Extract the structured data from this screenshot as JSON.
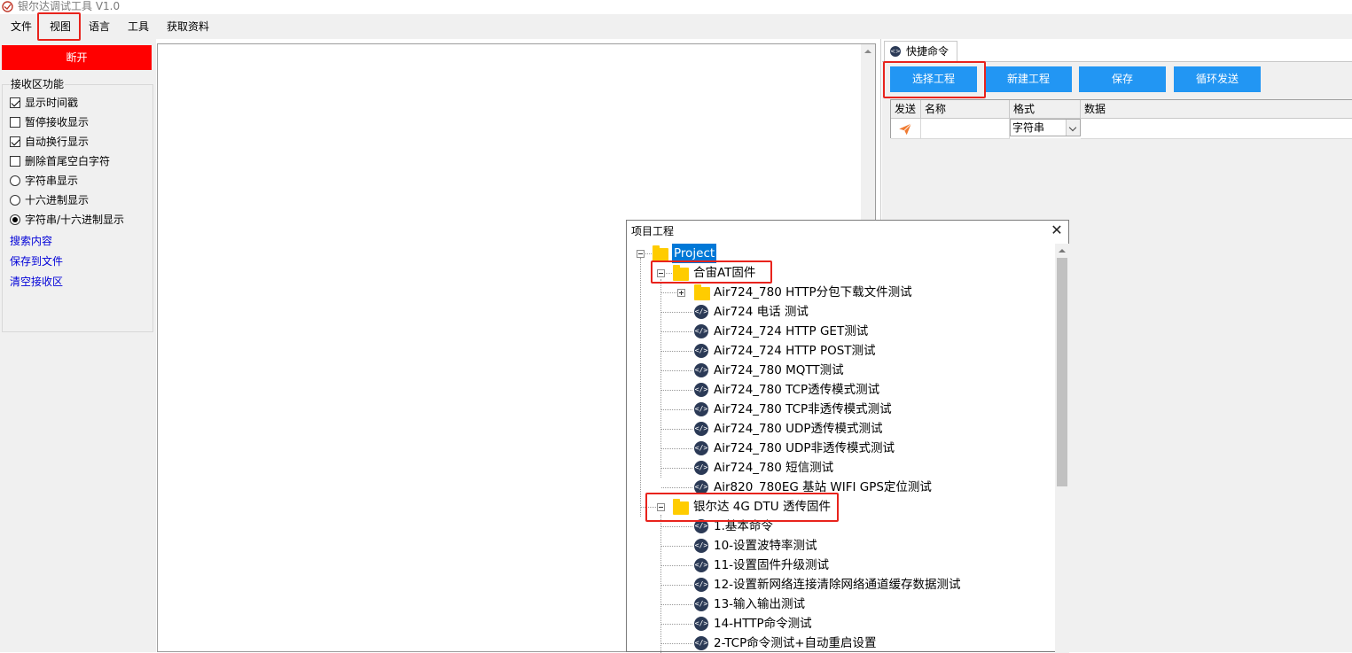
{
  "window": {
    "title": "银尔达调试工具 V1.0"
  },
  "menu": [
    "文件",
    "视图",
    "语言",
    "工具",
    "获取资料"
  ],
  "left_panel": {
    "disconnect_label": "断开",
    "group_title": "接收区功能",
    "options": [
      {
        "label": "显示时间戳",
        "type": "checkbox",
        "checked": true
      },
      {
        "label": "暂停接收显示",
        "type": "checkbox",
        "checked": false
      },
      {
        "label": "自动换行显示",
        "type": "checkbox",
        "checked": true
      },
      {
        "label": "删除首尾空白字符",
        "type": "checkbox",
        "checked": false
      },
      {
        "label": "字符串显示",
        "type": "radio",
        "checked": false
      },
      {
        "label": "十六进制显示",
        "type": "radio",
        "checked": false
      },
      {
        "label": "字符串/十六进制显示",
        "type": "radio",
        "checked": true
      }
    ],
    "links": [
      "搜索内容",
      "保存到文件",
      "清空接收区"
    ]
  },
  "quick_commands": {
    "tab_label": "快捷命令",
    "buttons": [
      "选择工程",
      "新建工程",
      "保存",
      "循环发送"
    ],
    "columns": [
      "发送",
      "名称",
      "格式",
      "数据"
    ],
    "row": {
      "format": "字符串"
    }
  },
  "project_dialog": {
    "title": "项目工程",
    "close_glyph": "✕",
    "root": "Project",
    "folder1": "合宙AT固件",
    "folder1_items": [
      "Air724_780 HTTP分包下载文件测试",
      "Air724 电话 测试",
      "Air724_724 HTTP GET测试",
      "Air724_724 HTTP POST测试",
      "Air724_780 MQTT测试",
      "Air724_780 TCP透传模式测试",
      "Air724_780 TCP非透传模式测试",
      "Air724_780 UDP透传模式测试",
      "Air724_780 UDP非透传模式测试",
      "Air724_780 短信测试",
      "Air820_780EG 基站 WIFI GPS定位测试"
    ],
    "folder2": "银尔达 4G DTU 透传固件",
    "folder2_items": [
      "1.基本命令",
      "10-设置波特率测试",
      "11-设置固件升级测试",
      "12-设置新网络连接清除网络通道缓存数据测试",
      "13-输入输出测试",
      "14-HTTP命令测试",
      "2-TCP命令测试+自动重启设置"
    ]
  },
  "colors": {
    "disconnect": "#ff0000",
    "button": "#2296f3",
    "highlight": "#e8231c",
    "folder": "#ffcc00",
    "selection": "#0078d7"
  }
}
